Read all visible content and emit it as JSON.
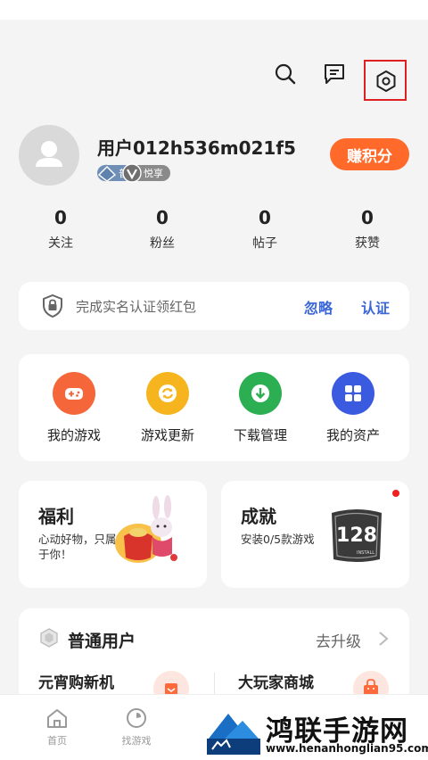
{
  "header": {
    "icons": [
      "search-icon",
      "message-icon",
      "settings-icon"
    ]
  },
  "profile": {
    "username": "用户012h536m021f5",
    "badge_card": "普卡",
    "badge_vip": "悦享",
    "earn_points_label": "赚积分"
  },
  "stats": [
    {
      "value": "0",
      "label": "关注"
    },
    {
      "value": "0",
      "label": "粉丝"
    },
    {
      "value": "0",
      "label": "帖子"
    },
    {
      "value": "0",
      "label": "获赞"
    }
  ],
  "verify": {
    "text": "完成实名认证领红包",
    "ignore_label": "忽略",
    "auth_label": "认证"
  },
  "quick_actions": [
    {
      "label": "我的游戏",
      "color": "#f5673a",
      "icon": "gamepad-icon"
    },
    {
      "label": "游戏更新",
      "color": "#f6b51e",
      "icon": "refresh-icon"
    },
    {
      "label": "下载管理",
      "color": "#2cae52",
      "icon": "download-icon"
    },
    {
      "label": "我的资产",
      "color": "#3a5be0",
      "icon": "grid-icon"
    }
  ],
  "welfare": {
    "title": "福利",
    "subtitle": "心动好物，只属于你！"
  },
  "achievement": {
    "title": "成就",
    "subtitle": "安装0/5款游戏",
    "art_number": "128",
    "art_caption": "INSTALL"
  },
  "member": {
    "title": "普通用户",
    "upgrade_label": "去升级",
    "shops": [
      {
        "title": "元宵购新机"
      },
      {
        "title": "大玩家商城"
      }
    ]
  },
  "tabbar": {
    "tabs": [
      {
        "label": "首页",
        "icon": "home-icon"
      },
      {
        "label": "找游戏",
        "icon": "find-game-icon"
      }
    ]
  },
  "watermark": {
    "title": "鸿联手游网",
    "url": "www.henanhonglian95.com"
  },
  "colors": {
    "accent_orange": "#ff6a2b",
    "link_blue": "#3b67d6",
    "highlight_red": "#e02020"
  }
}
